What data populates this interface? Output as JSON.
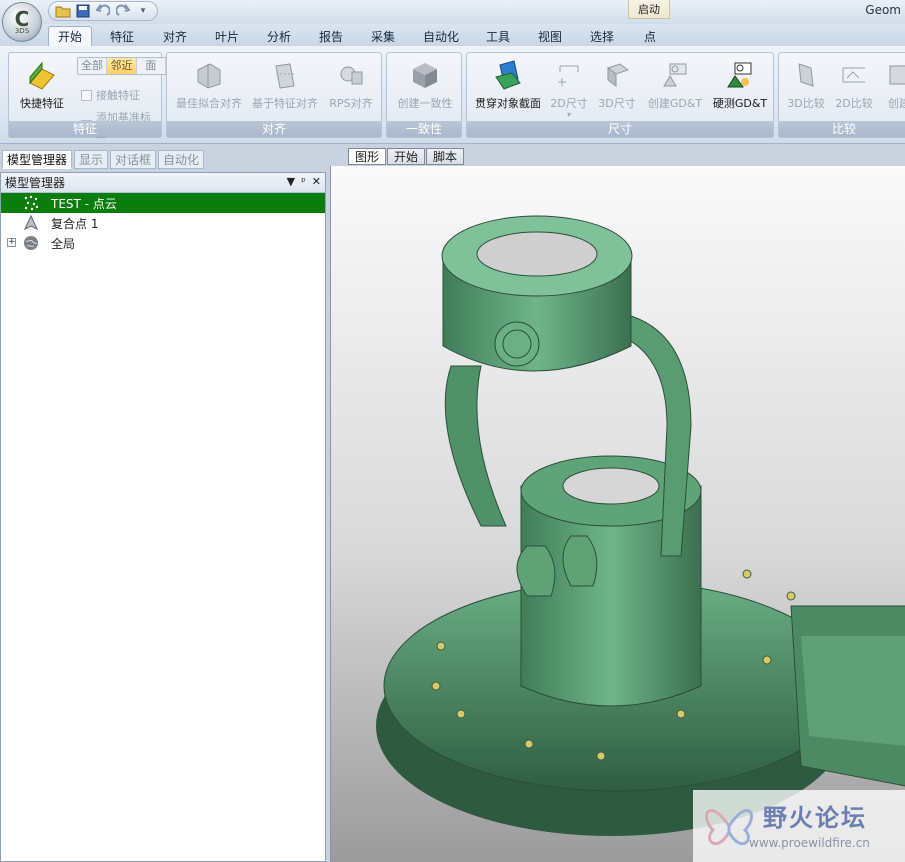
{
  "app": {
    "title": "Geom",
    "orb_letter": "C",
    "orb_sub": "3DS",
    "context_tab": "启动"
  },
  "ribbon": {
    "tabs": [
      "开始",
      "特征",
      "对齐",
      "叶片",
      "分析",
      "报告",
      "采集",
      "自动化",
      "工具",
      "视图",
      "选择",
      "点"
    ],
    "active_tab": "开始",
    "groups": {
      "features": {
        "label": "特征",
        "quick_button": "快捷特征",
        "segments": [
          "全部",
          "邻近",
          "面"
        ],
        "active_segment": "邻近",
        "check_contact": "接触特征",
        "check_datum": "添加基准标签"
      },
      "align": {
        "label": "对齐",
        "best_fit": "最佳拟合对齐",
        "feature_based": "基于特征对齐",
        "rps": "RPS对齐"
      },
      "consistency": {
        "label": "一致性",
        "create": "创建一致性"
      },
      "dimension": {
        "label": "尺寸",
        "cross_section": "贯穿对象截面",
        "dim2d": "2D尺寸",
        "dim3d": "3D尺寸",
        "create_gdt": "创建GD&T",
        "probe_gdt": "硬测GD&T"
      },
      "compare": {
        "label": "比较",
        "cmp3d": "3D比较",
        "cmp2d": "2D比较",
        "create": "创建"
      }
    }
  },
  "left_panel": {
    "tabs": [
      "模型管理器",
      "显示",
      "对话框",
      "自动化"
    ],
    "active_tab": "模型管理器",
    "header": "模型管理器",
    "header_btns": [
      "▼",
      "ᵖ",
      "✕"
    ],
    "tree": [
      {
        "label": "TEST - 点云",
        "selected": true
      },
      {
        "label": "复合点 1",
        "selected": false
      },
      {
        "label": "全局",
        "selected": false
      }
    ]
  },
  "viewport": {
    "tabs": [
      "图形",
      "开始",
      "脚本"
    ],
    "active_tab": "图形",
    "model_color": "#5e9e77"
  },
  "watermark": {
    "text": "野火论坛",
    "url": "www.proewildfire.cn"
  }
}
